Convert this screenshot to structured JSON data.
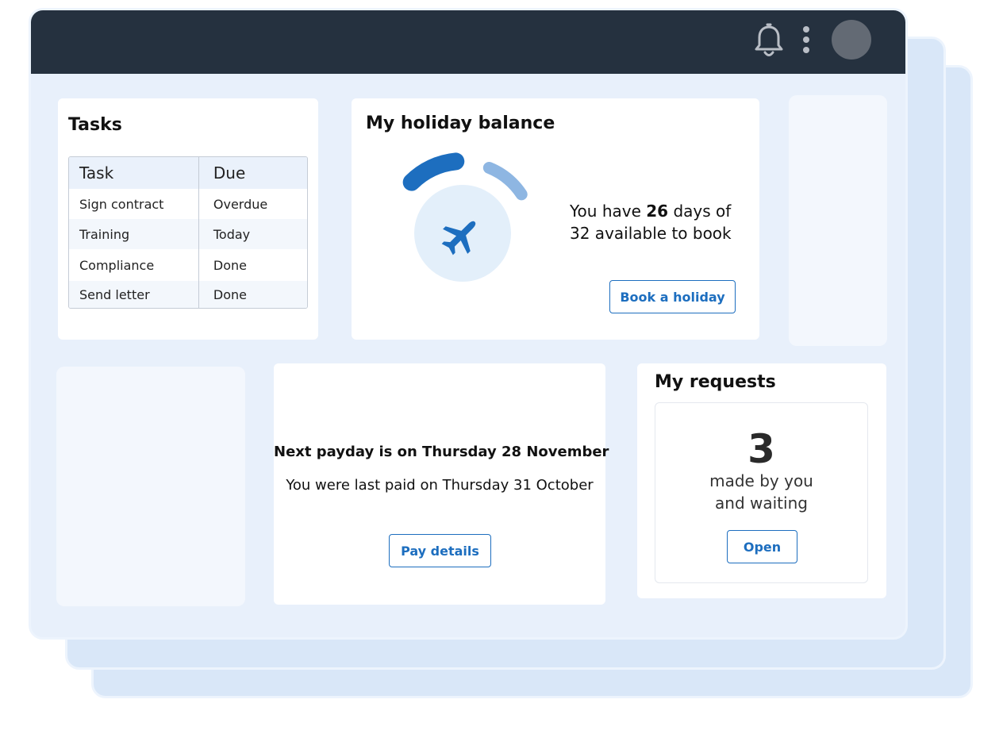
{
  "colors": {
    "topbar": "#25313f",
    "accent": "#1d6ebf",
    "ring_used": "#1d6ebf",
    "ring_remaining": "#8eb6e2",
    "ring_center": "#e3effa",
    "background": "#e8f0fb"
  },
  "header": {
    "notification_icon": "bell-icon",
    "menu_icon": "kebab-menu-icon"
  },
  "tasks": {
    "title": "Tasks",
    "columns": [
      "Task",
      "Due"
    ],
    "rows": [
      [
        "Sign contract",
        "Overdue"
      ],
      [
        "Training",
        "Today"
      ],
      [
        "Compliance",
        "Done"
      ],
      [
        "Send letter",
        "Done"
      ]
    ]
  },
  "holiday": {
    "title": "My holiday balance",
    "text_prefix": "You have ",
    "days_available": "26",
    "text_suffix": " days of 32 available to book",
    "days_total": 32,
    "icon": "airplane-icon",
    "button_label": "Book a holiday"
  },
  "payday": {
    "title": "Next payday is on Thursday 28 November",
    "subtitle": "You were last paid on Thursday 31 October",
    "button_label": "Pay details"
  },
  "requests": {
    "title": "My requests",
    "count": "3",
    "label": "made by you and waiting",
    "button_label": "Open"
  }
}
